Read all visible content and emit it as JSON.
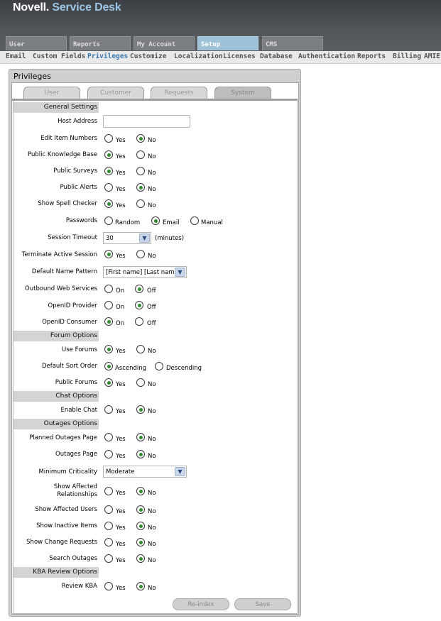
{
  "app": {
    "brand": "Novell",
    "product": "Service Desk"
  },
  "main_tabs": [
    {
      "label": "User",
      "active": false
    },
    {
      "label": "Reports",
      "active": false
    },
    {
      "label": "My Account",
      "active": false
    },
    {
      "label": "Setup",
      "active": true
    },
    {
      "label": "CMS",
      "active": false
    }
  ],
  "sub_nav": [
    {
      "label": "Email"
    },
    {
      "label": "Custom Fields"
    },
    {
      "label": "Privileges",
      "active": true
    },
    {
      "label": "Customize"
    },
    {
      "label": "Localization"
    },
    {
      "label": "Licenses"
    },
    {
      "label": "Database"
    },
    {
      "label": "Authentication"
    },
    {
      "label": "Reports"
    },
    {
      "label": "Billing"
    },
    {
      "label": "AMIE"
    }
  ],
  "panel": {
    "title": "Privileges"
  },
  "section_tabs": [
    {
      "label": "User",
      "active": false
    },
    {
      "label": "Customer",
      "active": false
    },
    {
      "label": "Requests",
      "active": false
    },
    {
      "label": "System",
      "active": true
    }
  ],
  "sections": {
    "general": "General Settings",
    "forum": "Forum Options",
    "chat": "Chat Options",
    "outages": "Outages Options",
    "kba": "KBA Review Options"
  },
  "fields": {
    "host_address": {
      "label": "Host Address",
      "value": ""
    },
    "edit_item_numbers": {
      "label": "Edit Item Numbers",
      "opt1": "Yes",
      "opt2": "No",
      "selected": "No"
    },
    "public_kb": {
      "label": "Public Knowledge Base",
      "opt1": "Yes",
      "opt2": "No",
      "selected": "Yes"
    },
    "public_surveys": {
      "label": "Public Surveys",
      "opt1": "Yes",
      "opt2": "No",
      "selected": "Yes"
    },
    "public_alerts": {
      "label": "Public Alerts",
      "opt1": "Yes",
      "opt2": "No",
      "selected": "No"
    },
    "spell_checker": {
      "label": "Show Spell Checker",
      "opt1": "Yes",
      "opt2": "No",
      "selected": "Yes"
    },
    "passwords": {
      "label": "Passwords",
      "opt1": "Random",
      "opt2": "Email",
      "opt3": "Manual",
      "selected": "Email"
    },
    "session_timeout": {
      "label": "Session Timeout",
      "value": "30",
      "unit": "(minutes)"
    },
    "terminate_session": {
      "label": "Terminate Active Session",
      "opt1": "Yes",
      "opt2": "No",
      "selected": "Yes"
    },
    "name_pattern": {
      "label": "Default Name Pattern",
      "value": "[First name] [Last nam"
    },
    "outbound_ws": {
      "label": "Outbound Web Services",
      "opt1": "On",
      "opt2": "Off",
      "selected": "Off"
    },
    "openid_provider": {
      "label": "OpenID Provider",
      "opt1": "On",
      "opt2": "Off",
      "selected": "Off"
    },
    "openid_consumer": {
      "label": "OpenID Consumer",
      "opt1": "On",
      "opt2": "Off",
      "selected": "On"
    },
    "use_forums": {
      "label": "Use Forums",
      "opt1": "Yes",
      "opt2": "No",
      "selected": "Yes"
    },
    "sort_order": {
      "label": "Default Sort Order",
      "opt1": "Ascending",
      "opt2": "Descending",
      "selected": "Ascending"
    },
    "public_forums": {
      "label": "Public Forums",
      "opt1": "Yes",
      "opt2": "No",
      "selected": "Yes"
    },
    "enable_chat": {
      "label": "Enable Chat",
      "opt1": "Yes",
      "opt2": "No",
      "selected": "No"
    },
    "planned_outages": {
      "label": "Planned Outages Page",
      "opt1": "Yes",
      "opt2": "No",
      "selected": "No"
    },
    "outages_page": {
      "label": "Outages Page",
      "opt1": "Yes",
      "opt2": "No",
      "selected": "No"
    },
    "min_criticality": {
      "label": "Minimum Criticality",
      "value": "Moderate"
    },
    "affected_rel": {
      "label_line1": "Show Affected",
      "label_line2": "Relationships",
      "opt1": "Yes",
      "opt2": "No",
      "selected": "No"
    },
    "affected_users": {
      "label": "Show Affected Users",
      "opt1": "Yes",
      "opt2": "No",
      "selected": "No"
    },
    "inactive_items": {
      "label": "Show Inactive Items",
      "opt1": "Yes",
      "opt2": "No",
      "selected": "No"
    },
    "change_requests": {
      "label": "Show Change Requests",
      "opt1": "Yes",
      "opt2": "No",
      "selected": "No"
    },
    "search_outages": {
      "label": "Search Outages",
      "opt1": "Yes",
      "opt2": "No",
      "selected": "No"
    },
    "review_kba": {
      "label": "Review KBA",
      "opt1": "Yes",
      "opt2": "No",
      "selected": "No"
    }
  },
  "buttons": {
    "reindex": "Re-index",
    "save": "Save"
  },
  "icons": {
    "select_arrow": "chevron-down-icon"
  }
}
